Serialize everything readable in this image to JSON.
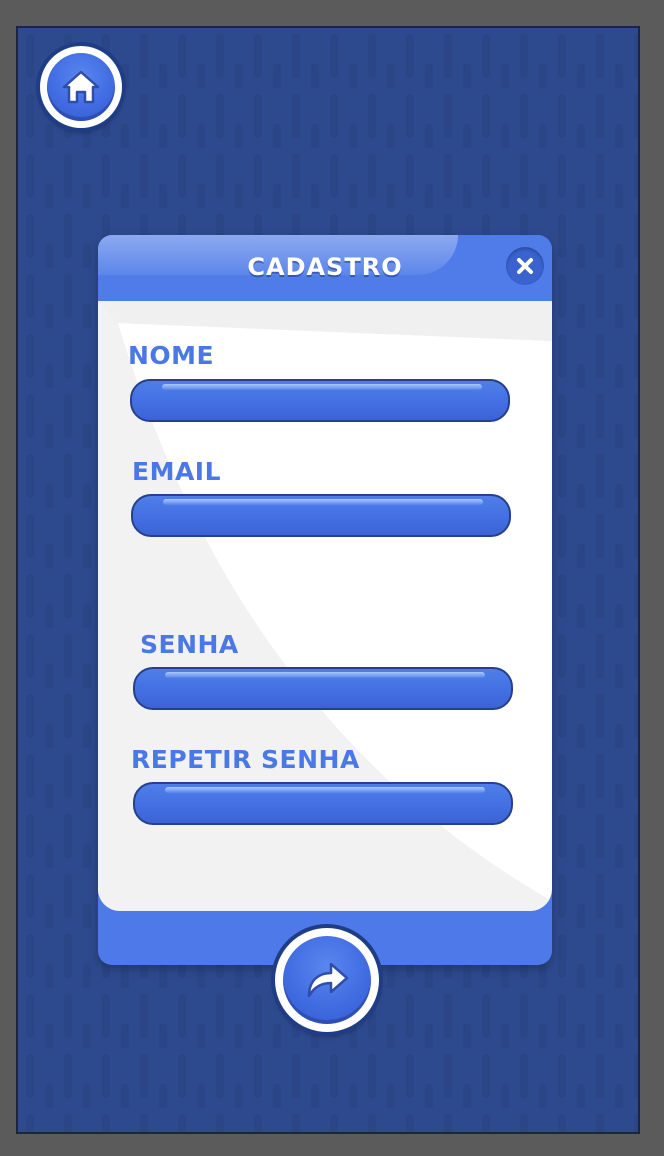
{
  "form": {
    "title": "CADASTRO",
    "fields": [
      {
        "label": "NOME",
        "value": "",
        "placeholder": ""
      },
      {
        "label": "EMAIL",
        "value": "",
        "placeholder": ""
      },
      {
        "label": "SENHA",
        "value": "",
        "placeholder": ""
      },
      {
        "label": "REPETIR SENHA",
        "value": "",
        "placeholder": ""
      }
    ]
  },
  "icons": {
    "home": "home-icon",
    "close": "close-icon",
    "submit": "forward-arrow-icon"
  },
  "colors": {
    "background": "#2e4a8e",
    "accent": "#4a78e6",
    "panel_body": "#ffffff",
    "frame": "#5b5b5b"
  }
}
